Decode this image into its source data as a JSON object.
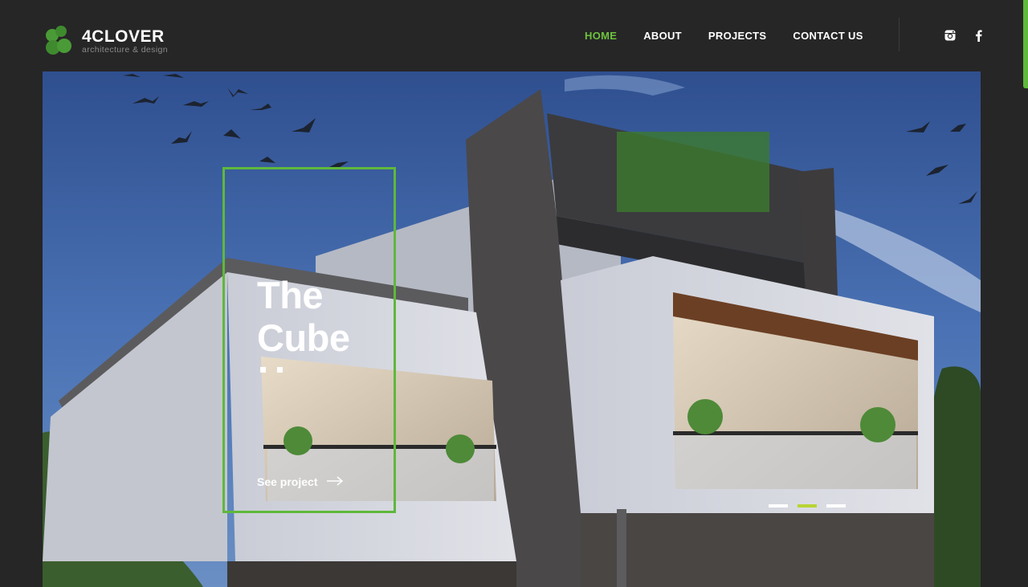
{
  "brand": {
    "name": "4CLOVER",
    "tagline": "architecture & design",
    "accent_color": "#5fb83b",
    "active_nav_color": "#6ec23f"
  },
  "nav": {
    "items": [
      {
        "label": "HOME",
        "active": true
      },
      {
        "label": "ABOUT",
        "active": false
      },
      {
        "label": "PROJECTS",
        "active": false
      },
      {
        "label": "CONTACT US",
        "active": false
      }
    ]
  },
  "social": {
    "icons": [
      "instagram-icon",
      "facebook-icon"
    ]
  },
  "hero": {
    "title_line1": "The",
    "title_line2": "Cube",
    "cta_label": "See project",
    "cta_icon": "arrow-right-icon",
    "slides_count": 3,
    "active_slide": 2,
    "active_pager_color": "#b8d433"
  }
}
